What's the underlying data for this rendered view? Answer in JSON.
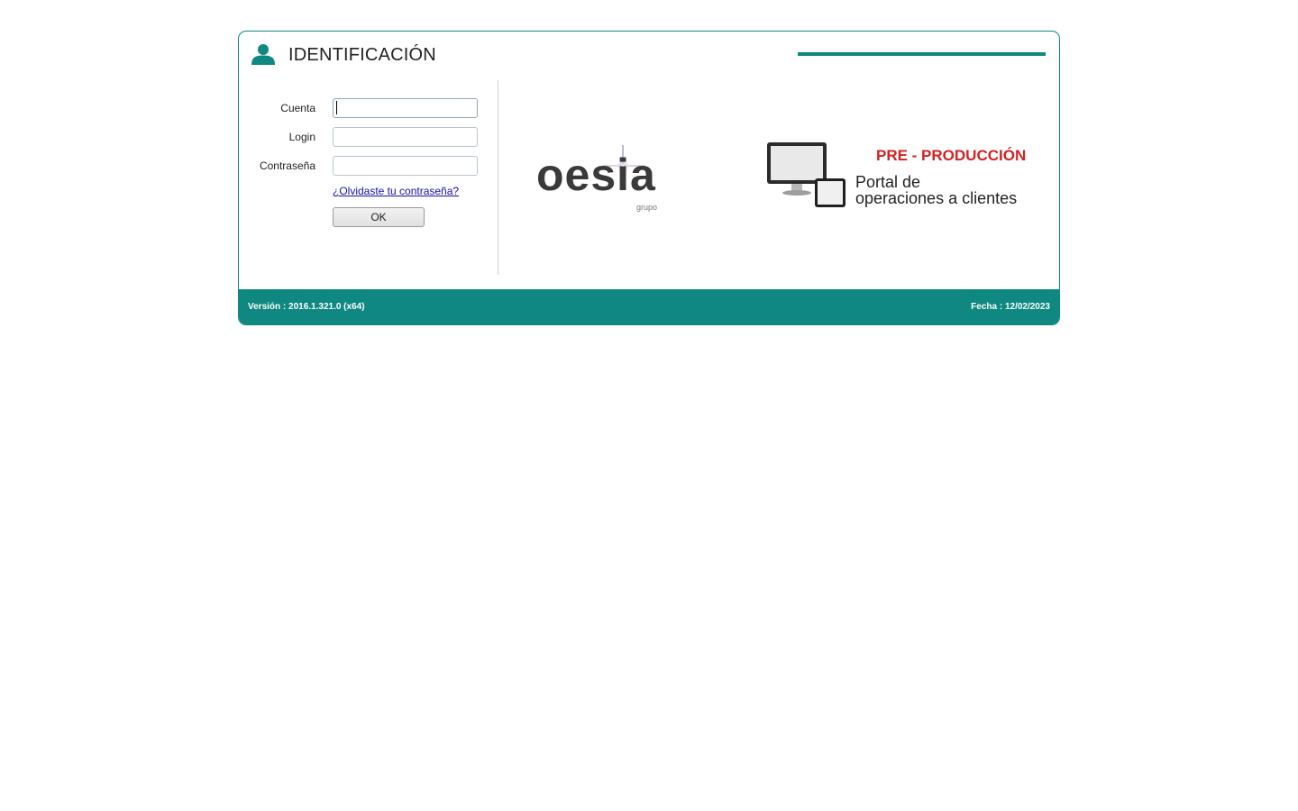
{
  "header": {
    "title": "IDENTIFICACIÓN",
    "icon": "user-icon",
    "accent_color": "#0e8880"
  },
  "form": {
    "account_label": "Cuenta",
    "account_value": "",
    "login_label": "Login",
    "login_value": "",
    "password_label": "Contraseña",
    "password_value": "",
    "forgot_link": "¿Olvidaste tu contraseña?",
    "ok_label": "OK"
  },
  "branding": {
    "logo_text": "oesia",
    "logo_sub": "grupo",
    "environment": "PRE - PRODUCCIÓN",
    "environment_color": "#d32222",
    "portal_line1": "Portal de",
    "portal_line2": "operaciones a clientes",
    "devices_icon": "monitor-tablet-icon"
  },
  "footer": {
    "version": "Versión : 2016.1.321.0 (x64)",
    "date": "Fecha : 12/02/2023"
  }
}
